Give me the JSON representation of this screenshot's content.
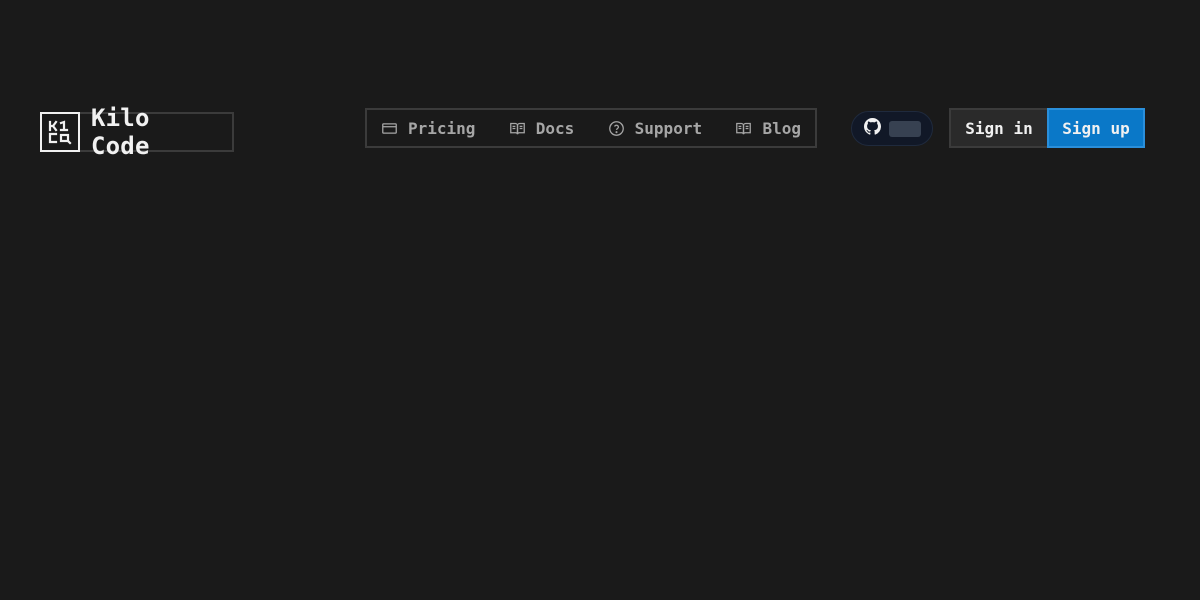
{
  "brand": {
    "logo_icon": "kilo-code-logo-icon",
    "name": "Kilo Code"
  },
  "nav": {
    "items": [
      {
        "label": "Pricing",
        "icon": "credit-card-icon"
      },
      {
        "label": "Docs",
        "icon": "book-open-icon"
      },
      {
        "label": "Support",
        "icon": "help-circle-icon"
      },
      {
        "label": "Blog",
        "icon": "book-open-icon"
      }
    ]
  },
  "github": {
    "icon": "github-icon",
    "star_count": ""
  },
  "auth": {
    "sign_in_label": "Sign in",
    "sign_up_label": "Sign up"
  },
  "colors": {
    "background": "#1a1a1a",
    "text": "#f1f1f1",
    "nav_text": "#a6a6a6",
    "border": "#3b3b3b",
    "accent": "#0a78c8"
  }
}
